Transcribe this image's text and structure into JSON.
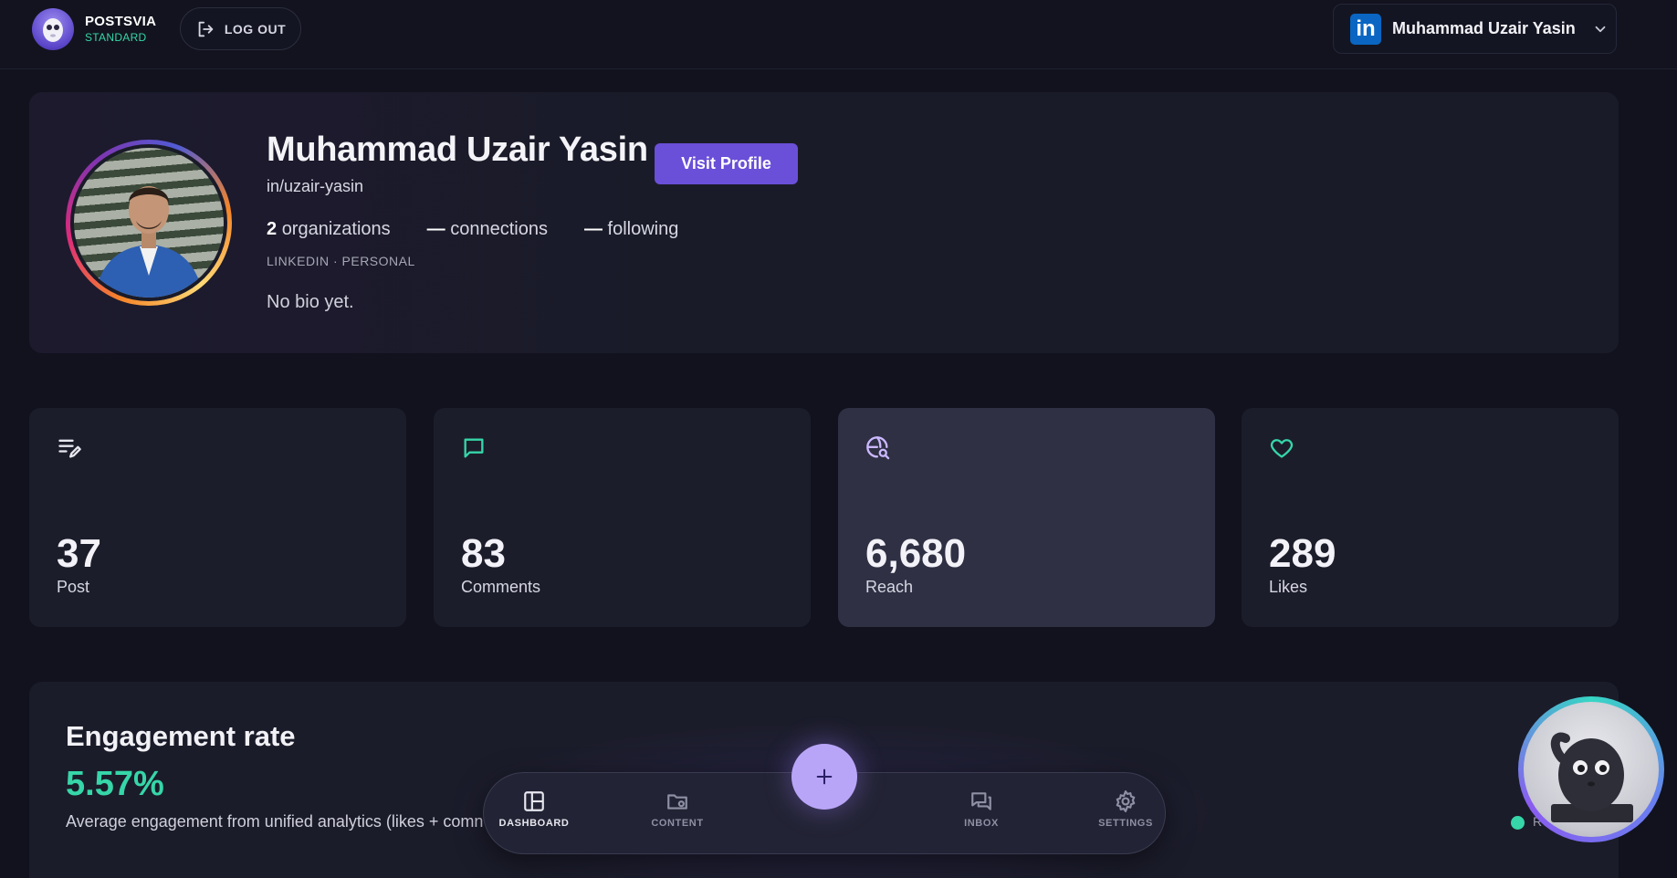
{
  "brand": {
    "name": "POSTSVIA",
    "tier": "STANDARD"
  },
  "header": {
    "logout_label": "LOG OUT",
    "account_name": "Muhammad Uzair Yasin",
    "account_platform_badge": "in"
  },
  "profile": {
    "name": "Muhammad Uzair Yasin",
    "visit_label": "Visit Profile",
    "handle": "in/uzair-yasin",
    "organizations_count": "2",
    "organizations_label": "organizations",
    "connections_count": "—",
    "connections_label": "connections",
    "following_count": "—",
    "following_label": "following",
    "platform": "LINKEDIN · PERSONAL",
    "bio": "No bio yet."
  },
  "metrics": [
    {
      "value": "37",
      "label": "Post",
      "icon": "post-edit-icon"
    },
    {
      "value": "83",
      "label": "Comments",
      "icon": "comment-icon"
    },
    {
      "value": "6,680",
      "label": "Reach",
      "icon": "reach-search-icon"
    },
    {
      "value": "289",
      "label": "Likes",
      "icon": "heart-icon"
    }
  ],
  "engagement": {
    "title": "Engagement rate",
    "value": "5.57%",
    "description": "Average engagement from unified analytics (likes + comn"
  },
  "nav": {
    "items": [
      {
        "label": "DASHBOARD",
        "icon": "dashboard-icon"
      },
      {
        "label": "CONTENT",
        "icon": "content-folder-icon"
      },
      {
        "label": "INBOX",
        "icon": "inbox-icon"
      },
      {
        "label": "SETTINGS",
        "icon": "settings-gear-icon"
      }
    ],
    "fab_symbol": "+"
  },
  "assistant": {
    "status_label": "R"
  },
  "colors": {
    "accent": "#6a4fd8",
    "positive": "#36d6a8",
    "linkedin": "#0a66c2",
    "fab": "#b9a5f8"
  }
}
